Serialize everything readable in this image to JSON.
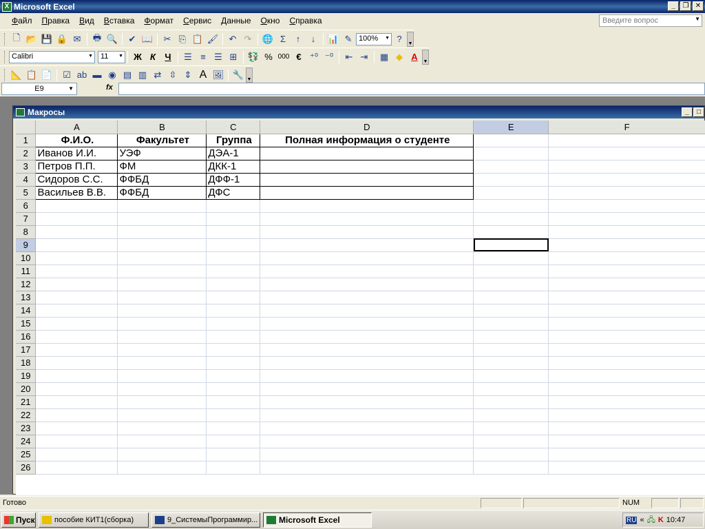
{
  "app": {
    "title": "Microsoft Excel"
  },
  "menu": [
    "Файл",
    "Правка",
    "Вид",
    "Вставка",
    "Формат",
    "Сервис",
    "Данные",
    "Окно",
    "Справка"
  ],
  "ask_placeholder": "Введите вопрос",
  "toolbar": {
    "zoom": "100%",
    "font": "Calibri",
    "size": "11",
    "bold": "Ж",
    "italic": "К",
    "underline": "Ч",
    "percent": "%",
    "thousands": "000",
    "euro": "€",
    "sigma": "Σ"
  },
  "formula_bar": {
    "cell_ref": "E9",
    "fx": "fx",
    "value": ""
  },
  "doc": {
    "title": "Макросы"
  },
  "sheet": {
    "columns": [
      "A",
      "B",
      "C",
      "D",
      "E",
      "F"
    ],
    "selected_col": "E",
    "selected_row": 9,
    "rows": [
      [
        "Ф.И.О.",
        "Факультет",
        "Группа",
        "Полная информация о студенте"
      ],
      [
        "Иванов И.И.",
        "УЭФ",
        "ДЭА-1",
        ""
      ],
      [
        "Петров П.П.",
        "ФМ",
        "ДКК-1",
        ""
      ],
      [
        "Сидоров С.С.",
        "ФФБД",
        "ДФФ-1",
        ""
      ],
      [
        "Васильев В.В.",
        "ФФБД",
        "ДФС",
        ""
      ]
    ],
    "row_count": 26
  },
  "status": {
    "ready": "Готово",
    "num": "NUM"
  },
  "taskbar": {
    "start": "Пуск",
    "tasks": [
      "пособие КИТ1(сборка)",
      "9_СистемыПрограммир...",
      "Microsoft Excel"
    ],
    "lang": "RU",
    "clock": "10:47"
  }
}
